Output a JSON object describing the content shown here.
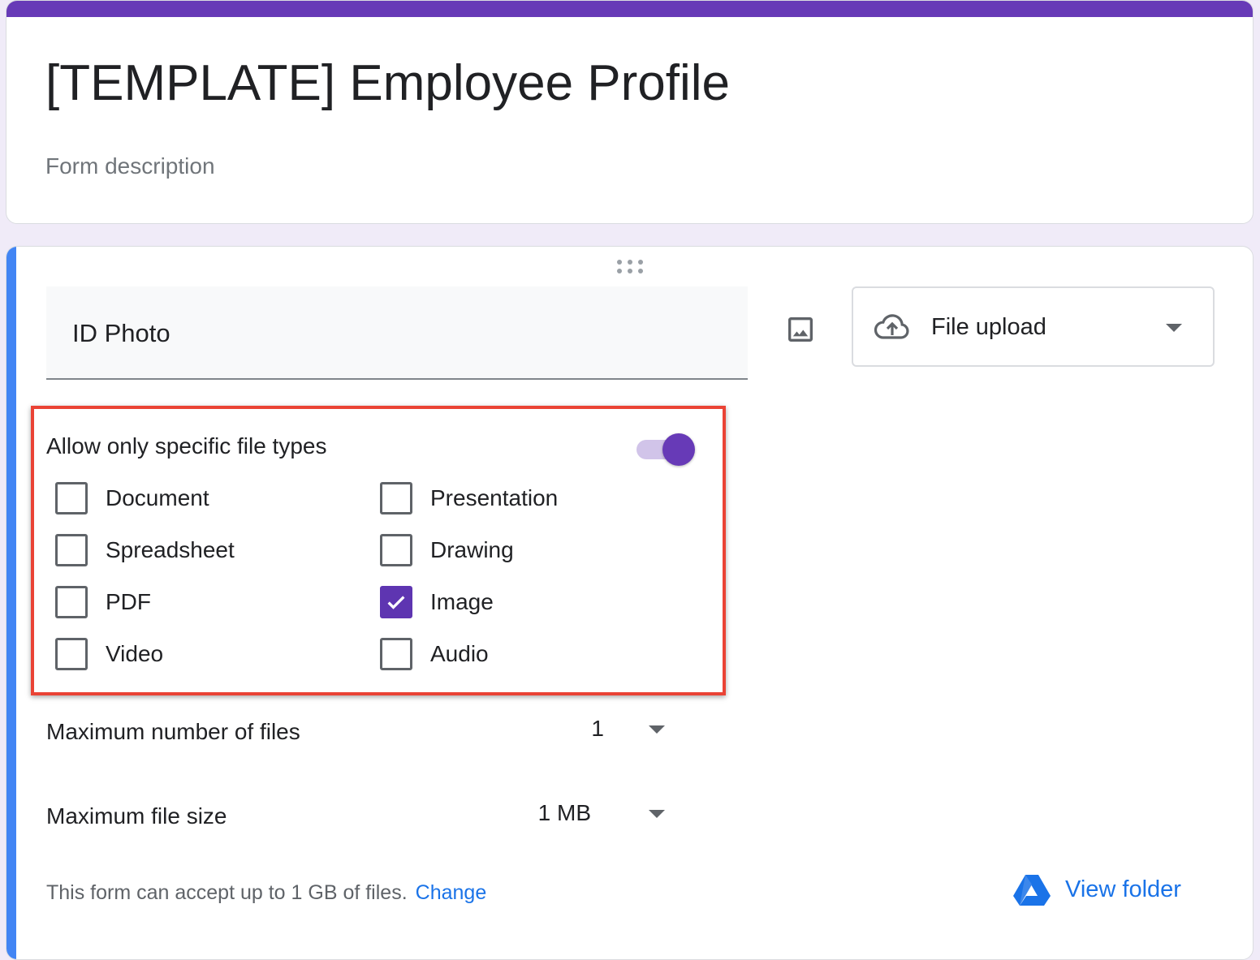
{
  "form": {
    "title": "[TEMPLATE] Employee Profile",
    "description_placeholder": "Form description"
  },
  "question": {
    "title": "ID Photo",
    "type_label": "File upload"
  },
  "file_types": {
    "label": "Allow only specific file types",
    "enabled": true,
    "options": [
      {
        "label": "Document",
        "checked": false
      },
      {
        "label": "Presentation",
        "checked": false
      },
      {
        "label": "Spreadsheet",
        "checked": false
      },
      {
        "label": "Drawing",
        "checked": false
      },
      {
        "label": "PDF",
        "checked": false
      },
      {
        "label": "Image",
        "checked": true
      },
      {
        "label": "Video",
        "checked": false
      },
      {
        "label": "Audio",
        "checked": false
      }
    ]
  },
  "settings": {
    "max_files_label": "Maximum number of files",
    "max_files_value": "1",
    "max_size_label": "Maximum file size",
    "max_size_value": "1 MB"
  },
  "footer": {
    "capacity_text": "This form can accept up to 1 GB of files.",
    "change_label": "Change",
    "view_folder_label": "View folder"
  },
  "colors": {
    "accent_purple": "#673ab7",
    "question_accent_blue": "#4285f4",
    "highlight_red": "#ea4335",
    "link_blue": "#1a73e8"
  }
}
